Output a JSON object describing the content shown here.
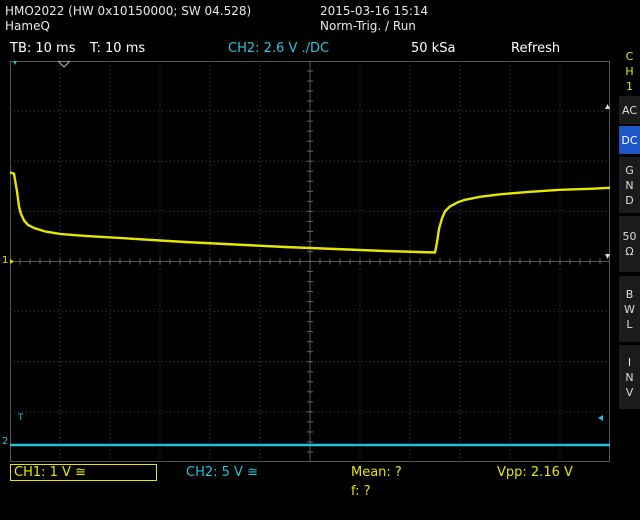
{
  "header": {
    "device_info": "HMO2022 (HW 0x10150000; SW 04.528)",
    "vendor": "HameQ",
    "datetime": "2015-03-16 15:14",
    "trigger_status": "Norm-Trig. / Run"
  },
  "info_bar": {
    "timebase": "TB: 10 ms",
    "trigger_time": "T: 10 ms",
    "trigger_channel": "CH2: 2.6 V ./DC",
    "sample_rate": "50 kSa",
    "mode": "Refresh"
  },
  "side_menu": {
    "channel": [
      "C",
      "H",
      "1"
    ],
    "items": [
      {
        "label": [
          "AC"
        ],
        "active": false
      },
      {
        "label": [
          "DC"
        ],
        "active": true
      },
      {
        "label": [
          "G",
          "N",
          "D"
        ],
        "active": false
      },
      {
        "label": [
          "50",
          "Ω"
        ],
        "active": false
      },
      {
        "label": [
          "B",
          "W",
          "L"
        ],
        "active": false
      },
      {
        "label": [
          "I",
          "N",
          "V"
        ],
        "active": false
      }
    ]
  },
  "markers": {
    "ch1_ground": "1",
    "ch2_ground": "2",
    "trigger_level": "T"
  },
  "bottom": {
    "ch1": "CH1: 1 V ≅",
    "ch2": "CH2: 5 V ≅",
    "mean": "Mean: ?",
    "freq": "f: ?",
    "vpp": "Vpp: 2.16 V"
  },
  "colors": {
    "ch1": "#e6e600",
    "ch2": "#22c3d8",
    "info_text": "#2ec7d8",
    "grid": "#4a4a4a",
    "active_key": "#1f56c6"
  },
  "chart_data": {
    "type": "line",
    "title": "",
    "xlabel": "",
    "ylabel": "",
    "x_unit": "ms",
    "xlim": [
      -50,
      70
    ],
    "grid": true,
    "series": [
      {
        "name": "CH1",
        "units": "V",
        "ylim": [
          -2.4,
          5.6
        ],
        "x": [
          -50,
          -49.2,
          -48.6,
          -48.2,
          -47.8,
          -47.2,
          -46.4,
          -45,
          -43,
          -40,
          -35,
          -25,
          -15,
          -5,
          5,
          15,
          25,
          35,
          35.4,
          35.8,
          36.4,
          37,
          38,
          39.5,
          41,
          44,
          48,
          54,
          60,
          66,
          70
        ],
        "values": [
          3.38,
          3.35,
          3.0,
          2.7,
          2.55,
          2.42,
          2.33,
          2.26,
          2.2,
          2.15,
          2.11,
          2.05,
          1.99,
          1.94,
          1.89,
          1.85,
          1.81,
          1.78,
          1.98,
          2.25,
          2.46,
          2.6,
          2.7,
          2.78,
          2.83,
          2.89,
          2.94,
          2.99,
          3.03,
          3.05,
          3.07
        ]
      },
      {
        "name": "CH2",
        "units": "V",
        "ylim": [
          -20,
          20
        ],
        "x": [
          -50,
          70
        ],
        "values": [
          -18.3,
          -18.3
        ]
      }
    ]
  }
}
